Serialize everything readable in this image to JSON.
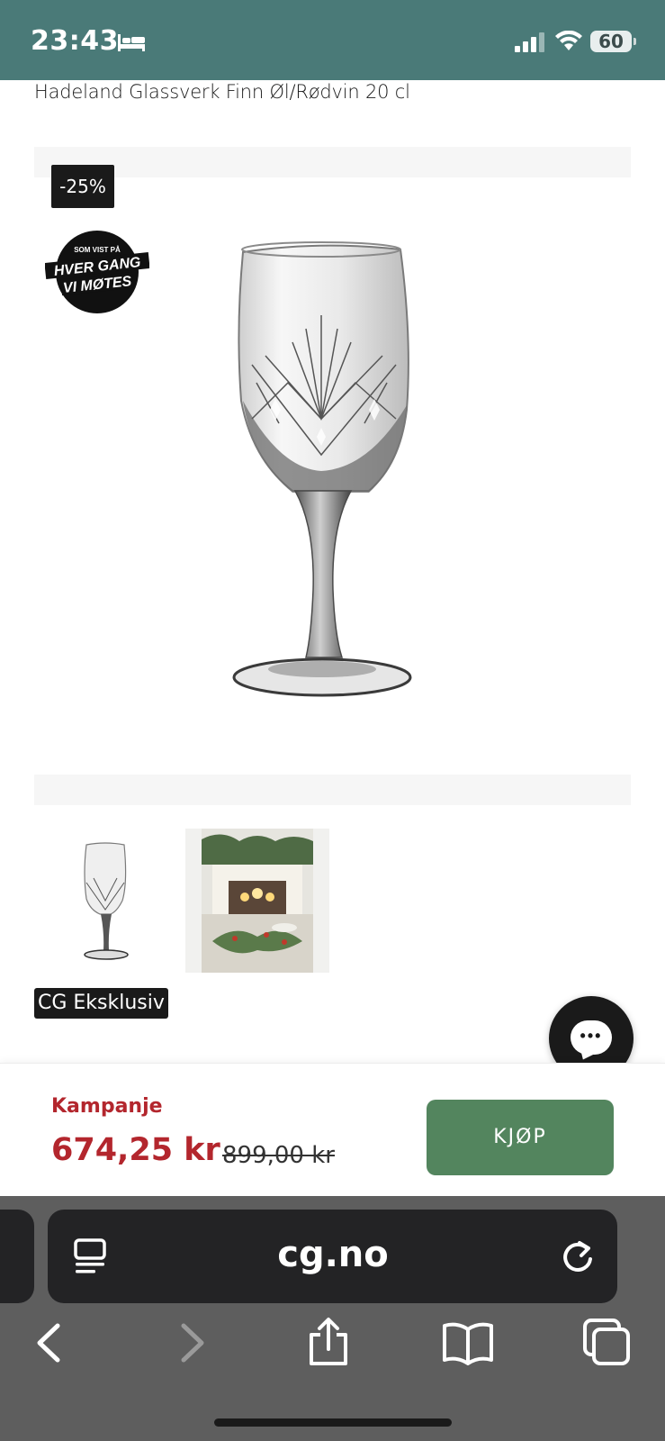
{
  "status_bar": {
    "time": "23:43",
    "battery_level": "60",
    "icons": [
      "bed-icon",
      "signal-icon",
      "wifi-icon",
      "battery-icon"
    ]
  },
  "product": {
    "title": "Hadeland Glassverk Finn Øl/Rødvin 20 cl",
    "discount_badge": "-25%",
    "tv_badge": {
      "small_text": "SOM VIST PÅ",
      "line1": "HVER GANG",
      "line2": "VI MØTES"
    },
    "exclusive_badge": "CG Eksklusiv"
  },
  "price_bar": {
    "campaign_label": "Kampanje",
    "current_price": "674,25 kr",
    "old_price": "899,00 kr",
    "buy_label": "KJØP",
    "price_color": "#b3262d",
    "buy_color": "#53855e"
  },
  "browser": {
    "url": "cg.no",
    "toolbar_icons": [
      "back-icon",
      "forward-icon",
      "share-icon",
      "bookmarks-icon",
      "tabs-icon"
    ]
  },
  "colors": {
    "status_bar": "#4a7a78",
    "browser_chrome": "#5e5e5e"
  }
}
